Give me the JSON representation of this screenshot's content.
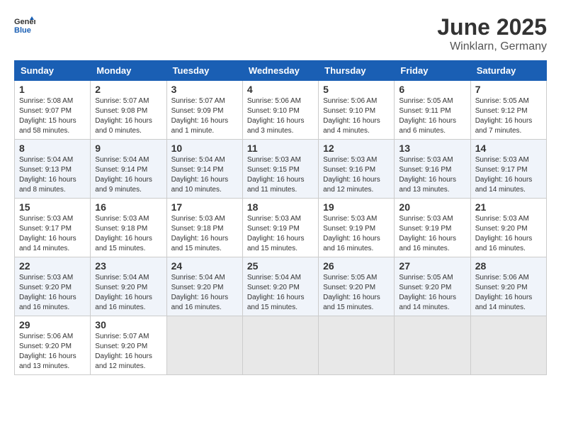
{
  "header": {
    "logo_line1": "General",
    "logo_line2": "Blue",
    "month": "June 2025",
    "location": "Winklarn, Germany"
  },
  "weekdays": [
    "Sunday",
    "Monday",
    "Tuesday",
    "Wednesday",
    "Thursday",
    "Friday",
    "Saturday"
  ],
  "weeks": [
    [
      {
        "day": "1",
        "sunrise": "5:08 AM",
        "sunset": "9:07 PM",
        "daylight": "15 hours and 58 minutes."
      },
      {
        "day": "2",
        "sunrise": "5:07 AM",
        "sunset": "9:08 PM",
        "daylight": "16 hours and 0 minutes."
      },
      {
        "day": "3",
        "sunrise": "5:07 AM",
        "sunset": "9:09 PM",
        "daylight": "16 hours and 1 minute."
      },
      {
        "day": "4",
        "sunrise": "5:06 AM",
        "sunset": "9:10 PM",
        "daylight": "16 hours and 3 minutes."
      },
      {
        "day": "5",
        "sunrise": "5:06 AM",
        "sunset": "9:10 PM",
        "daylight": "16 hours and 4 minutes."
      },
      {
        "day": "6",
        "sunrise": "5:05 AM",
        "sunset": "9:11 PM",
        "daylight": "16 hours and 6 minutes."
      },
      {
        "day": "7",
        "sunrise": "5:05 AM",
        "sunset": "9:12 PM",
        "daylight": "16 hours and 7 minutes."
      }
    ],
    [
      {
        "day": "8",
        "sunrise": "5:04 AM",
        "sunset": "9:13 PM",
        "daylight": "16 hours and 8 minutes."
      },
      {
        "day": "9",
        "sunrise": "5:04 AM",
        "sunset": "9:14 PM",
        "daylight": "16 hours and 9 minutes."
      },
      {
        "day": "10",
        "sunrise": "5:04 AM",
        "sunset": "9:14 PM",
        "daylight": "16 hours and 10 minutes."
      },
      {
        "day": "11",
        "sunrise": "5:03 AM",
        "sunset": "9:15 PM",
        "daylight": "16 hours and 11 minutes."
      },
      {
        "day": "12",
        "sunrise": "5:03 AM",
        "sunset": "9:16 PM",
        "daylight": "16 hours and 12 minutes."
      },
      {
        "day": "13",
        "sunrise": "5:03 AM",
        "sunset": "9:16 PM",
        "daylight": "16 hours and 13 minutes."
      },
      {
        "day": "14",
        "sunrise": "5:03 AM",
        "sunset": "9:17 PM",
        "daylight": "16 hours and 14 minutes."
      }
    ],
    [
      {
        "day": "15",
        "sunrise": "5:03 AM",
        "sunset": "9:17 PM",
        "daylight": "16 hours and 14 minutes."
      },
      {
        "day": "16",
        "sunrise": "5:03 AM",
        "sunset": "9:18 PM",
        "daylight": "16 hours and 15 minutes."
      },
      {
        "day": "17",
        "sunrise": "5:03 AM",
        "sunset": "9:18 PM",
        "daylight": "16 hours and 15 minutes."
      },
      {
        "day": "18",
        "sunrise": "5:03 AM",
        "sunset": "9:19 PM",
        "daylight": "16 hours and 15 minutes."
      },
      {
        "day": "19",
        "sunrise": "5:03 AM",
        "sunset": "9:19 PM",
        "daylight": "16 hours and 16 minutes."
      },
      {
        "day": "20",
        "sunrise": "5:03 AM",
        "sunset": "9:19 PM",
        "daylight": "16 hours and 16 minutes."
      },
      {
        "day": "21",
        "sunrise": "5:03 AM",
        "sunset": "9:20 PM",
        "daylight": "16 hours and 16 minutes."
      }
    ],
    [
      {
        "day": "22",
        "sunrise": "5:03 AM",
        "sunset": "9:20 PM",
        "daylight": "16 hours and 16 minutes."
      },
      {
        "day": "23",
        "sunrise": "5:04 AM",
        "sunset": "9:20 PM",
        "daylight": "16 hours and 16 minutes."
      },
      {
        "day": "24",
        "sunrise": "5:04 AM",
        "sunset": "9:20 PM",
        "daylight": "16 hours and 16 minutes."
      },
      {
        "day": "25",
        "sunrise": "5:04 AM",
        "sunset": "9:20 PM",
        "daylight": "16 hours and 15 minutes."
      },
      {
        "day": "26",
        "sunrise": "5:05 AM",
        "sunset": "9:20 PM",
        "daylight": "16 hours and 15 minutes."
      },
      {
        "day": "27",
        "sunrise": "5:05 AM",
        "sunset": "9:20 PM",
        "daylight": "16 hours and 14 minutes."
      },
      {
        "day": "28",
        "sunrise": "5:06 AM",
        "sunset": "9:20 PM",
        "daylight": "16 hours and 14 minutes."
      }
    ],
    [
      {
        "day": "29",
        "sunrise": "5:06 AM",
        "sunset": "9:20 PM",
        "daylight": "16 hours and 13 minutes."
      },
      {
        "day": "30",
        "sunrise": "5:07 AM",
        "sunset": "9:20 PM",
        "daylight": "16 hours and 12 minutes."
      },
      null,
      null,
      null,
      null,
      null
    ]
  ],
  "labels": {
    "sunrise": "Sunrise:",
    "sunset": "Sunset:",
    "daylight": "Daylight:"
  }
}
